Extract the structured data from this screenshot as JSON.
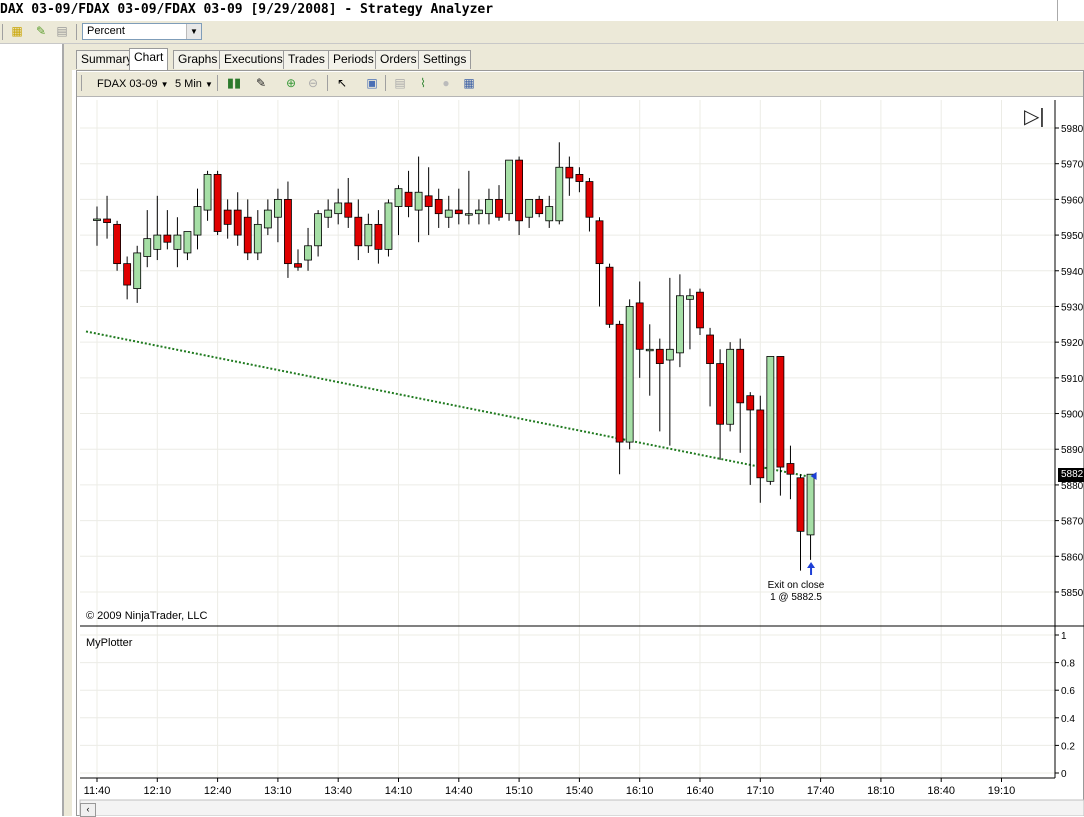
{
  "window": {
    "title": "DAX 03-09/FDAX 03-09/FDAX 03-09 [9/29/2008] - Strategy Analyzer"
  },
  "toolbar": {
    "display_select": "Percent"
  },
  "tabs": [
    {
      "label": "Summary",
      "active": false
    },
    {
      "label": "Chart",
      "active": true
    },
    {
      "label": "Graphs",
      "active": false
    },
    {
      "label": "Executions",
      "active": false
    },
    {
      "label": "Trades",
      "active": false
    },
    {
      "label": "Periods",
      "active": false
    },
    {
      "label": "Orders",
      "active": false
    },
    {
      "label": "Settings",
      "active": false
    }
  ],
  "chart_toolbar": {
    "instrument": "FDAX 03-09",
    "interval": "5 Min"
  },
  "chart": {
    "copyright": "© 2009 NinjaTrader, LLC",
    "indicator_label": "MyPlotter",
    "price_marker": "5882",
    "execution_label_1": "Exit on close",
    "execution_label_2": "1 @ 5882.5"
  },
  "colors": {
    "up": "#a6dfa6",
    "down": "#e00000",
    "trendline": "#1f7a1f",
    "exit_marker": "#1e3fd6",
    "grid": "#ecece6"
  },
  "chart_data": {
    "type": "candlestick",
    "title": "",
    "ylim": [
      5842,
      5986
    ],
    "y_ticks": [
      5850,
      5860,
      5870,
      5880,
      5890,
      5900,
      5910,
      5920,
      5930,
      5940,
      5950,
      5960,
      5970,
      5980
    ],
    "x_tick_labels": [
      "11:40",
      "12:10",
      "12:40",
      "13:10",
      "13:40",
      "14:10",
      "14:40",
      "15:10",
      "15:40",
      "16:10",
      "16:40",
      "17:10",
      "17:40",
      "18:10",
      "18:40",
      "19:10"
    ],
    "indicator_ylim": [
      0,
      1
    ],
    "indicator_ticks": [
      "0",
      "0.2",
      "0.4",
      "0.6",
      "0.8",
      "1"
    ],
    "bar_interval_minutes": 5,
    "bars": [
      {
        "t": "11:40",
        "o": 5954.5,
        "h": 5958,
        "l": 5947,
        "c": 5954.5
      },
      {
        "t": "11:45",
        "o": 5954.5,
        "h": 5961,
        "l": 5949,
        "c": 5953.5
      },
      {
        "t": "11:50",
        "o": 5953,
        "h": 5954,
        "l": 5940,
        "c": 5942
      },
      {
        "t": "11:55",
        "o": 5942,
        "h": 5944,
        "l": 5932,
        "c": 5936
      },
      {
        "t": "12:00",
        "o": 5935,
        "h": 5947,
        "l": 5931,
        "c": 5945
      },
      {
        "t": "12:05",
        "o": 5944,
        "h": 5957,
        "l": 5941,
        "c": 5949
      },
      {
        "t": "12:10",
        "o": 5946,
        "h": 5961,
        "l": 5943,
        "c": 5950
      },
      {
        "t": "12:15",
        "o": 5950,
        "h": 5957,
        "l": 5946,
        "c": 5948
      },
      {
        "t": "12:20",
        "o": 5946,
        "h": 5955,
        "l": 5941,
        "c": 5950
      },
      {
        "t": "12:25",
        "o": 5945,
        "h": 5951,
        "l": 5943,
        "c": 5951
      },
      {
        "t": "12:30",
        "o": 5950,
        "h": 5963,
        "l": 5946,
        "c": 5958
      },
      {
        "t": "12:35",
        "o": 5957,
        "h": 5968,
        "l": 5954,
        "c": 5967
      },
      {
        "t": "12:40",
        "o": 5967,
        "h": 5968,
        "l": 5950,
        "c": 5951
      },
      {
        "t": "12:45",
        "o": 5957,
        "h": 5960,
        "l": 5949,
        "c": 5953
      },
      {
        "t": "12:50",
        "o": 5957,
        "h": 5962,
        "l": 5947,
        "c": 5950
      },
      {
        "t": "12:55",
        "o": 5955,
        "h": 5960,
        "l": 5943,
        "c": 5945
      },
      {
        "t": "13:00",
        "o": 5945,
        "h": 5957,
        "l": 5943,
        "c": 5953
      },
      {
        "t": "13:05",
        "o": 5952,
        "h": 5960,
        "l": 5950,
        "c": 5957
      },
      {
        "t": "13:10",
        "o": 5955,
        "h": 5963,
        "l": 5948,
        "c": 5960
      },
      {
        "t": "13:15",
        "o": 5960,
        "h": 5965,
        "l": 5938,
        "c": 5942
      },
      {
        "t": "13:20",
        "o": 5942,
        "h": 5946,
        "l": 5940,
        "c": 5941
      },
      {
        "t": "13:25",
        "o": 5943,
        "h": 5952,
        "l": 5940,
        "c": 5947
      },
      {
        "t": "13:30",
        "o": 5947,
        "h": 5957,
        "l": 5944,
        "c": 5956
      },
      {
        "t": "13:35",
        "o": 5955,
        "h": 5960,
        "l": 5952,
        "c": 5957
      },
      {
        "t": "13:40",
        "o": 5956,
        "h": 5963,
        "l": 5953,
        "c": 5959
      },
      {
        "t": "13:45",
        "o": 5959,
        "h": 5966,
        "l": 5952,
        "c": 5955
      },
      {
        "t": "13:50",
        "o": 5955,
        "h": 5960,
        "l": 5943,
        "c": 5947
      },
      {
        "t": "13:55",
        "o": 5947,
        "h": 5956,
        "l": 5945,
        "c": 5953
      },
      {
        "t": "14:00",
        "o": 5953,
        "h": 5957,
        "l": 5942,
        "c": 5946
      },
      {
        "t": "14:05",
        "o": 5946,
        "h": 5960,
        "l": 5944,
        "c": 5959
      },
      {
        "t": "14:10",
        "o": 5958,
        "h": 5964,
        "l": 5950,
        "c": 5963
      },
      {
        "t": "14:15",
        "o": 5962,
        "h": 5968,
        "l": 5955,
        "c": 5958
      },
      {
        "t": "14:20",
        "o": 5957,
        "h": 5972,
        "l": 5948,
        "c": 5962
      },
      {
        "t": "14:25",
        "o": 5961,
        "h": 5969,
        "l": 5950,
        "c": 5958
      },
      {
        "t": "14:30",
        "o": 5960,
        "h": 5963,
        "l": 5952,
        "c": 5956
      },
      {
        "t": "14:35",
        "o": 5955,
        "h": 5961,
        "l": 5952,
        "c": 5957
      },
      {
        "t": "14:40",
        "o": 5957,
        "h": 5963,
        "l": 5953,
        "c": 5956
      },
      {
        "t": "14:45",
        "o": 5956,
        "h": 5968,
        "l": 5953,
        "c": 5956
      },
      {
        "t": "14:50",
        "o": 5956,
        "h": 5960,
        "l": 5953,
        "c": 5957
      },
      {
        "t": "14:55",
        "o": 5956,
        "h": 5963,
        "l": 5953,
        "c": 5960
      },
      {
        "t": "15:00",
        "o": 5960,
        "h": 5964,
        "l": 5954,
        "c": 5955
      },
      {
        "t": "15:05",
        "o": 5956,
        "h": 5970,
        "l": 5954,
        "c": 5971
      },
      {
        "t": "15:10",
        "o": 5971,
        "h": 5972,
        "l": 5950,
        "c": 5954
      },
      {
        "t": "15:15",
        "o": 5955,
        "h": 5960,
        "l": 5952,
        "c": 5960
      },
      {
        "t": "15:20",
        "o": 5960,
        "h": 5961,
        "l": 5955,
        "c": 5956
      },
      {
        "t": "15:25",
        "o": 5954,
        "h": 5961,
        "l": 5952,
        "c": 5958
      },
      {
        "t": "15:30",
        "o": 5954,
        "h": 5976,
        "l": 5953,
        "c": 5969
      },
      {
        "t": "15:35",
        "o": 5969,
        "h": 5972,
        "l": 5961,
        "c": 5966
      },
      {
        "t": "15:40",
        "o": 5967,
        "h": 5969,
        "l": 5962,
        "c": 5965
      },
      {
        "t": "15:45",
        "o": 5965,
        "h": 5966,
        "l": 5951,
        "c": 5955
      },
      {
        "t": "15:50",
        "o": 5954,
        "h": 5955,
        "l": 5930,
        "c": 5942
      },
      {
        "t": "15:55",
        "o": 5941,
        "h": 5942,
        "l": 5924,
        "c": 5925
      },
      {
        "t": "16:00",
        "o": 5925,
        "h": 5926,
        "l": 5883,
        "c": 5892
      },
      {
        "t": "16:05",
        "o": 5892,
        "h": 5932,
        "l": 5890,
        "c": 5930
      },
      {
        "t": "16:10",
        "o": 5931,
        "h": 5937,
        "l": 5910,
        "c": 5918
      },
      {
        "t": "16:15",
        "o": 5918,
        "h": 5925,
        "l": 5905,
        "c": 5918
      },
      {
        "t": "16:20",
        "o": 5918,
        "h": 5921,
        "l": 5895,
        "c": 5914
      },
      {
        "t": "16:25",
        "o": 5915,
        "h": 5938,
        "l": 5891,
        "c": 5918
      },
      {
        "t": "16:30",
        "o": 5917,
        "h": 5939,
        "l": 5913,
        "c": 5933
      },
      {
        "t": "16:35",
        "o": 5932,
        "h": 5935,
        "l": 5918,
        "c": 5933
      },
      {
        "t": "16:40",
        "o": 5934,
        "h": 5935,
        "l": 5922,
        "c": 5924
      },
      {
        "t": "16:45",
        "o": 5922,
        "h": 5924,
        "l": 5902,
        "c": 5914
      },
      {
        "t": "16:50",
        "o": 5914,
        "h": 5918,
        "l": 5887,
        "c": 5897
      },
      {
        "t": "16:55",
        "o": 5897,
        "h": 5920,
        "l": 5895,
        "c": 5918
      },
      {
        "t": "17:00",
        "o": 5918,
        "h": 5921,
        "l": 5889,
        "c": 5903
      },
      {
        "t": "17:05",
        "o": 5905,
        "h": 5906,
        "l": 5880,
        "c": 5901
      },
      {
        "t": "17:10",
        "o": 5901,
        "h": 5905,
        "l": 5875,
        "c": 5882
      },
      {
        "t": "17:15",
        "o": 5881,
        "h": 5916,
        "l": 5880,
        "c": 5916
      },
      {
        "t": "17:20",
        "o": 5916,
        "h": 5916,
        "l": 5877,
        "c": 5885
      },
      {
        "t": "17:25",
        "o": 5886,
        "h": 5891,
        "l": 5876,
        "c": 5883
      },
      {
        "t": "17:30",
        "o": 5882,
        "h": 5883,
        "l": 5856,
        "c": 5867
      },
      {
        "t": "17:35",
        "o": 5866,
        "h": 5881,
        "l": 5859,
        "c": 5883
      }
    ],
    "trendline": {
      "from": {
        "t": "11:40",
        "y": 5923
      },
      "to": {
        "t": "17:35",
        "y": 5882
      }
    },
    "exit_execution": {
      "t": "17:35",
      "price": 5882.5
    }
  }
}
